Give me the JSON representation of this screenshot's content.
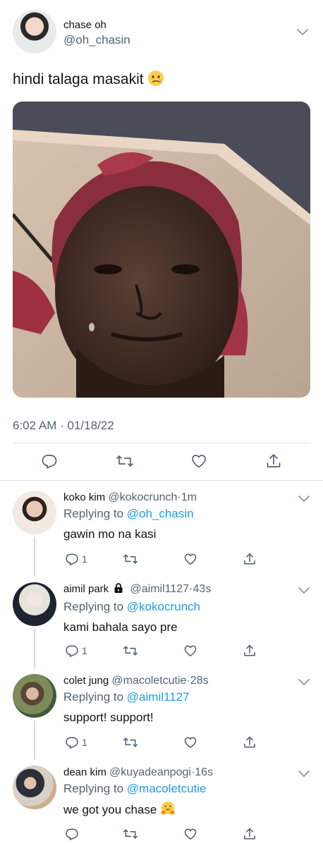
{
  "main_tweet": {
    "author_name": "chase oh",
    "author_handle": "@oh_chasin",
    "text": "hindi talaga masakit",
    "timestamp": "6:02 AM · 01/18/22"
  },
  "replies": [
    {
      "name": "koko kim",
      "handle": "@kokocrunch",
      "dot": "·",
      "time": "1m",
      "replying_prefix": "Replying to",
      "replying_to": "@oh_chasin",
      "text": "gawin mo na kasi",
      "reply_count": "1"
    },
    {
      "name": "aimil park",
      "handle": "@aimil1127",
      "dot": "·",
      "time": "43s",
      "replying_prefix": "Replying to",
      "replying_to": "@kokocrunch",
      "text": "kami bahala sayo pre",
      "reply_count": "1",
      "protected": true
    },
    {
      "name": "colet jung",
      "handle": "@macoletcutie",
      "dot": "·",
      "time": "28s",
      "replying_prefix": "Replying to",
      "replying_to": "@aimil1127",
      "text": "support! support!",
      "reply_count": "1"
    },
    {
      "name": "dean kim",
      "handle": "@kuyadeanpogi",
      "dot": "·",
      "time": "16s",
      "replying_prefix": "Replying to",
      "replying_to": "@macoletcutie",
      "text": "we got you chase",
      "reply_count": ""
    }
  ],
  "colors": {
    "link": "#1d9bf0",
    "secondary_text": "#536471",
    "divider": "#dfe3e6"
  },
  "icons": [
    "chevron-down-icon",
    "reply-icon",
    "retweet-icon",
    "like-icon",
    "share-icon",
    "lock-icon",
    "face-holding-back-tears-emoji",
    "hugging-face-emoji"
  ]
}
